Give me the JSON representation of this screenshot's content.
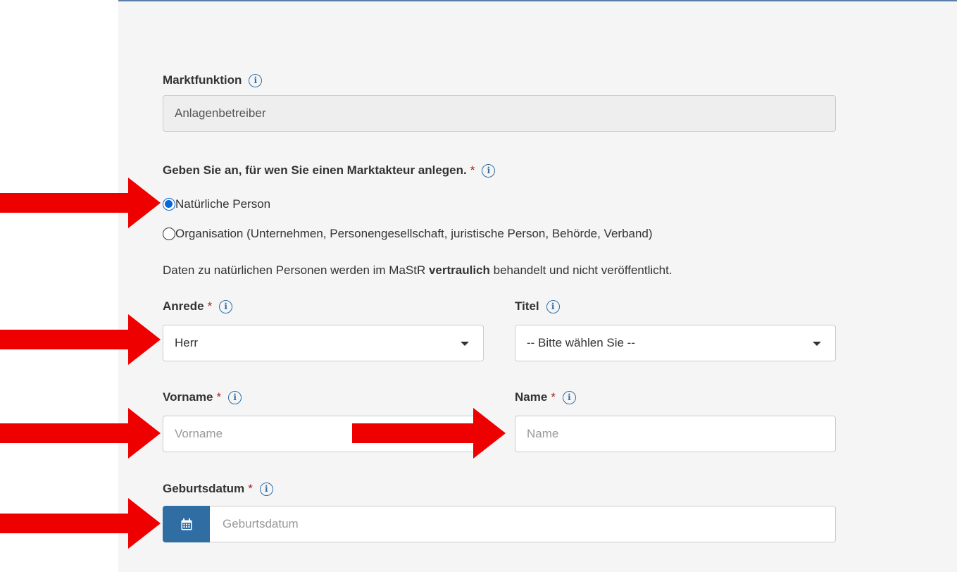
{
  "marktfunktion": {
    "label": "Marktfunktion",
    "value": "Anlagenbetreiber"
  },
  "akteur_typ": {
    "question": "Geben Sie an, für wen Sie einen Marktakteur anlegen.",
    "required_mark": "*",
    "options": [
      {
        "label": "Natürliche Person",
        "selected": true
      },
      {
        "label": "Organisation (Unternehmen, Personengesellschaft, juristische Person, Behörde, Verband)",
        "selected": false
      }
    ]
  },
  "privacy_note": {
    "before": "Daten zu natürlichen Personen werden im MaStR ",
    "bold": "vertraulich",
    "after": " behandelt und nicht veröffentlicht."
  },
  "anrede": {
    "label": "Anrede",
    "required_mark": "*",
    "value": "Herr"
  },
  "titel": {
    "label": "Titel",
    "value": "-- Bitte wählen Sie --"
  },
  "vorname": {
    "label": "Vorname",
    "required_mark": "*",
    "placeholder": "Vorname"
  },
  "name": {
    "label": "Name",
    "required_mark": "*",
    "placeholder": "Name"
  },
  "geburtsdatum": {
    "label": "Geburtsdatum",
    "required_mark": "*",
    "placeholder": "Geburtsdatum"
  },
  "info_glyph": "i",
  "icons": {
    "info": "info-circle-icon",
    "calendar": "calendar-icon",
    "dropdown": "caret-down-icon",
    "annotation": "red-arrow"
  },
  "colors": {
    "accent": "#2f6da3",
    "required": "#a51f24",
    "radio_selected": "#0a66d6",
    "annotation_arrow": "#ee0000",
    "panel_background": "#f5f5f5"
  }
}
